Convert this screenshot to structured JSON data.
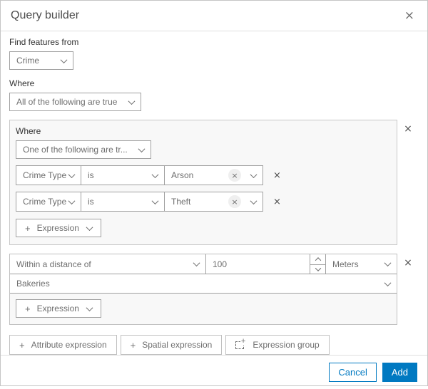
{
  "dialog": {
    "title": "Query builder"
  },
  "icons": {
    "close": "×",
    "remove": "×",
    "clear": "×",
    "plus": "+"
  },
  "find_from": {
    "label": "Find features from",
    "value": "Crime"
  },
  "where": {
    "label": "Where",
    "combinator": "All of the following are true"
  },
  "group1": {
    "label": "Where",
    "combinator": "One of the following are tr...",
    "rows": [
      {
        "field": "Crime Type",
        "operator": "is",
        "value": "Arson"
      },
      {
        "field": "Crime Type",
        "operator": "is",
        "value": "Theft"
      }
    ],
    "add_expression_label": "Expression"
  },
  "group2": {
    "operator": "Within a distance of",
    "distance_value": "100",
    "unit": "Meters",
    "layer": "Bakeries",
    "add_expression_label": "Expression"
  },
  "actions": {
    "attribute_expression": "Attribute expression",
    "spatial_expression": "Spatial expression",
    "expression_group": "Expression group"
  },
  "footer": {
    "cancel": "Cancel",
    "add": "Add"
  },
  "colors": {
    "accent": "#0079c1",
    "group_bg": "#f8f8f8"
  }
}
